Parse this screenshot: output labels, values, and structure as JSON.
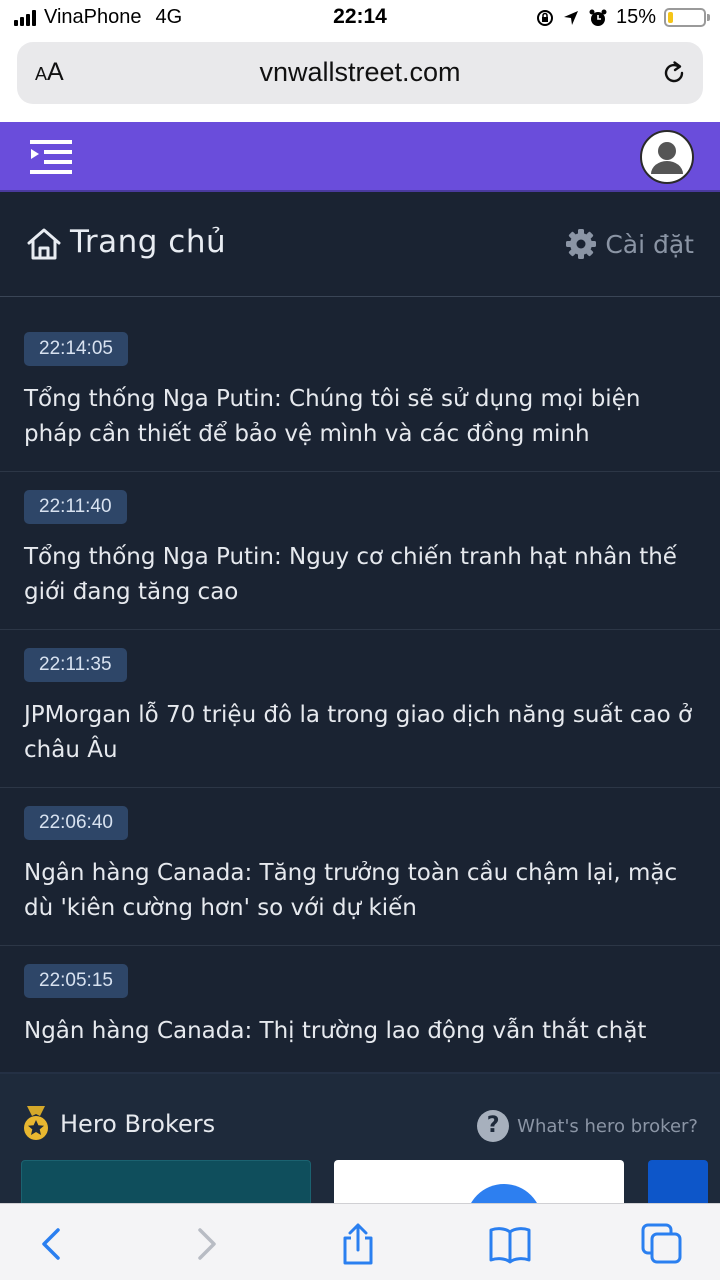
{
  "status_bar": {
    "carrier": "VinaPhone",
    "network": "4G",
    "time": "22:14",
    "battery_percent": "15%",
    "battery_level": 0.15
  },
  "browser": {
    "text_size_button": {
      "small": "A",
      "large": "A"
    },
    "url": "vnwallstreet.com"
  },
  "colors": {
    "header_bg": "#6a4ddb",
    "page_bg": "#1a2332",
    "badge_bg": "#2e4668",
    "battery_fill": "#f5c518"
  },
  "page": {
    "title": "Trang chủ",
    "settings_label": "Cài đặt",
    "icons": [
      "menu-icon",
      "profile-icon",
      "home-icon",
      "gear-icon"
    ]
  },
  "news": [
    {
      "time": "22:14:05",
      "headline": "Tổng thống Nga Putin: Chúng tôi sẽ sử dụng mọi biện pháp cần thiết để bảo vệ mình và các đồng minh"
    },
    {
      "time": "22:11:40",
      "headline": "Tổng thống Nga Putin: Nguy cơ chiến tranh hạt nhân thế giới đang tăng cao"
    },
    {
      "time": "22:11:35",
      "headline": "JPMorgan lỗ 70 triệu đô la trong giao dịch năng suất cao ở châu Âu"
    },
    {
      "time": "22:06:40",
      "headline": "Ngân hàng Canada: Tăng trưởng toàn cầu chậm lại, mặc dù 'kiên cường hơn' so với dự kiến"
    },
    {
      "time": "22:05:15",
      "headline": "Ngân hàng Canada: Thị trường lao động vẫn thắt chặt"
    }
  ],
  "hero_brokers": {
    "title": "Hero Brokers",
    "help_glyph": "?",
    "help_link": "What's hero broker?"
  },
  "toolbar": {
    "icons": [
      "back-icon",
      "forward-icon",
      "share-icon",
      "bookmarks-icon",
      "tabs-icon"
    ]
  }
}
